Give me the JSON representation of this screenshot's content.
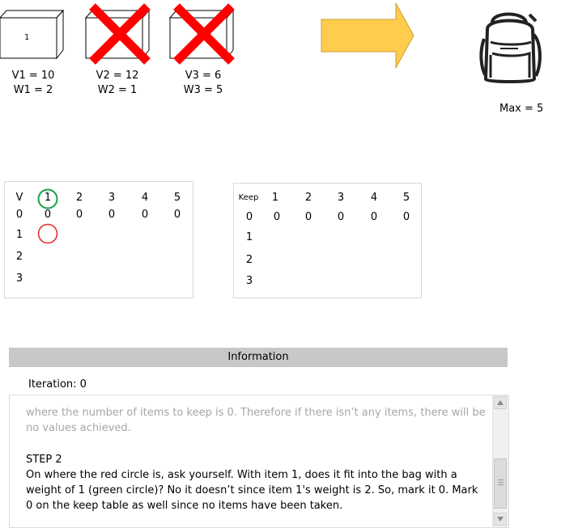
{
  "items": [
    {
      "box_label": "1",
      "value_label": "V1 = 10",
      "weight_label": "W1 = 2",
      "crossed": false
    },
    {
      "box_label": "",
      "value_label": "V2 = 12",
      "weight_label": "W2 = 1",
      "crossed": true
    },
    {
      "box_label": "",
      "value_label": "V3 = 6",
      "weight_label": "W3 = 5",
      "crossed": true
    }
  ],
  "bag": {
    "max_label": "Max = 5"
  },
  "value_table": {
    "header": [
      "V",
      "1",
      "2",
      "3",
      "4",
      "5"
    ],
    "rows": [
      {
        "label": "0",
        "values": [
          "0",
          "0",
          "0",
          "0",
          "0"
        ]
      },
      {
        "label": "1",
        "values": []
      },
      {
        "label": "2",
        "values": []
      },
      {
        "label": "3",
        "values": []
      }
    ],
    "green_circle": "row header, column 1",
    "red_circle": "row 1, column 1"
  },
  "keep_table": {
    "header": [
      "Keep",
      "1",
      "2",
      "3",
      "4",
      "5"
    ],
    "rows": [
      {
        "label": "0",
        "values": [
          "0",
          "0",
          "0",
          "0",
          "0"
        ]
      },
      {
        "label": "1",
        "values": []
      },
      {
        "label": "2",
        "values": []
      },
      {
        "label": "3",
        "values": []
      }
    ]
  },
  "information": {
    "title": "Information",
    "iteration": "Iteration: 0",
    "faded_text": "where the number of items to keep is 0. Therefore if there isn’t any items, there will be no values achieved.",
    "step_title": "STEP 2",
    "step_body": "On where the red circle is, ask yourself. With item 1, does it fit into the bag with a weight of 1 (green circle)? No it doesn’t since item 1's weight is 2. So, mark it 0. Mark 0 on the keep table as well since no items have been taken."
  },
  "colors": {
    "cross": "#ff0000",
    "arrow": "#ffcc4d",
    "green_circle": "#1aa34a",
    "red_circle": "#e62e2e",
    "header_bg": "#c8c8c8",
    "faded_text": "#a6a6a6"
  },
  "icons": [
    "box-icon",
    "cross-icon",
    "arrow-right-icon",
    "backpack-icon",
    "scroll-up-icon",
    "scroll-down-icon"
  ]
}
